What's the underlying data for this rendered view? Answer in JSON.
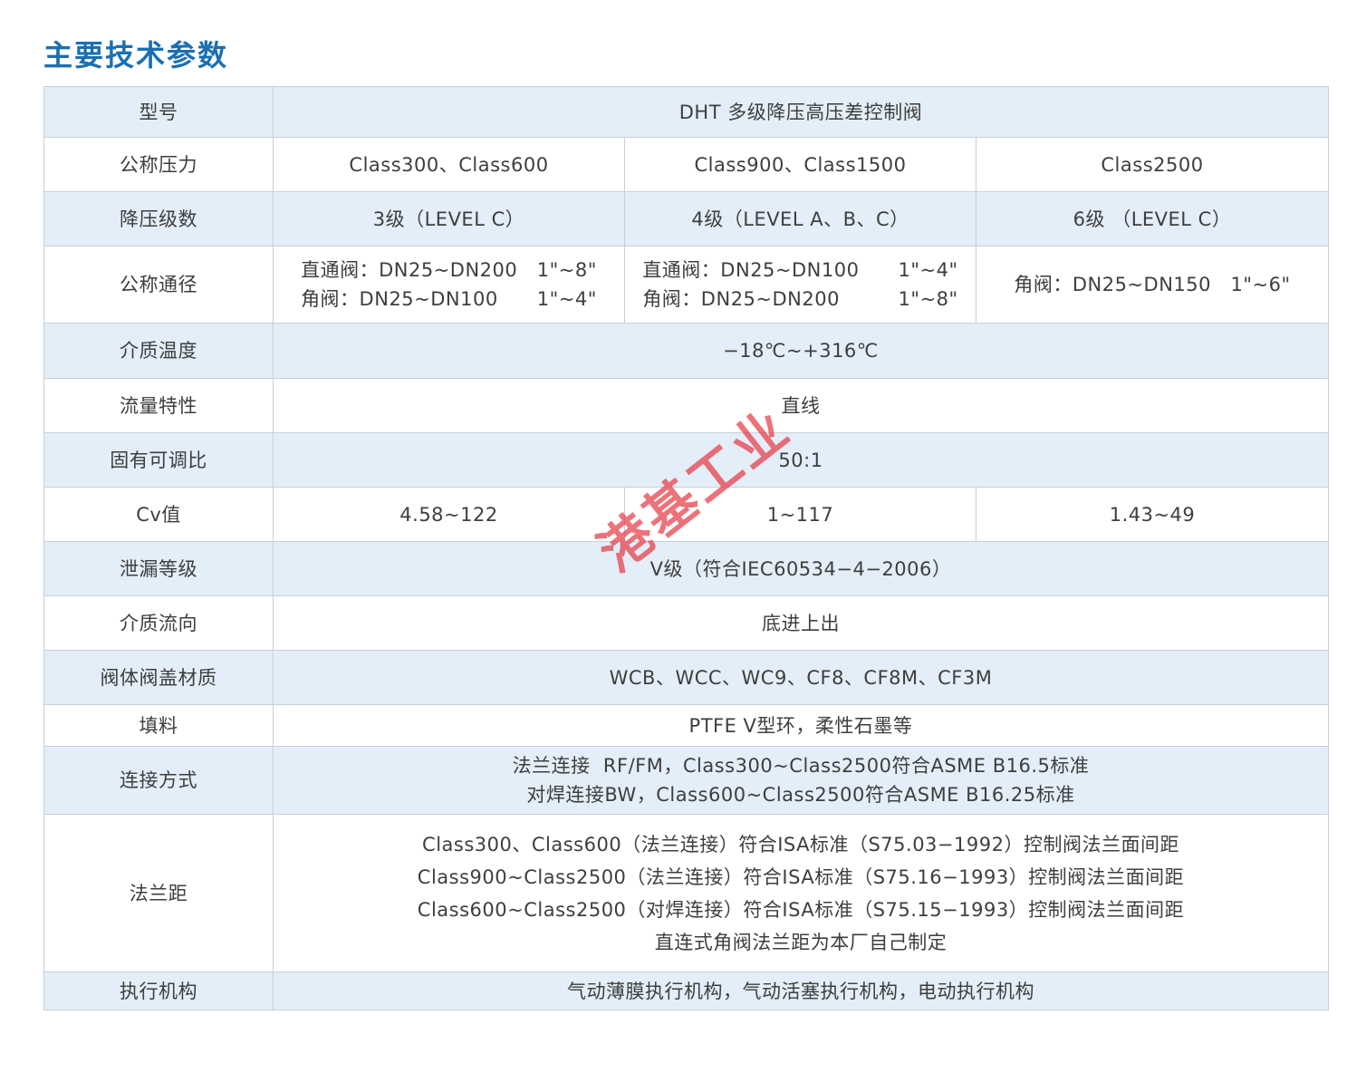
{
  "heading": "主要技术参数",
  "rows": [
    {
      "label": "型号",
      "value": "DHT 多级降压高压差控制阀"
    },
    {
      "label": "公称压力",
      "cells": [
        "Class300、Class600",
        "Class900、Class1500",
        "Class2500"
      ]
    },
    {
      "label": "降压级数",
      "cells": [
        "3级（LEVEL C）",
        "4级（LEVEL A、B、C）",
        "6级 （LEVEL C）"
      ]
    },
    {
      "label": "公称通径",
      "c1": [
        "直通阀：DN25~DN200   1\"~8\"",
        "角阀：DN25~DN100      1\"~4\""
      ],
      "c2": [
        "直通阀：DN25~DN100      1\"~4\"",
        "角阀：DN25~DN200         1\"~8\""
      ],
      "c3": "角阀：DN25~DN150   1\"~6\""
    },
    {
      "label": "介质温度",
      "value": "−18℃~+316℃"
    },
    {
      "label": "流量特性",
      "value": "直线"
    },
    {
      "label": "固有可调比",
      "value": "50:1"
    },
    {
      "label": "Cv值",
      "cells": [
        "4.58~122",
        "1~117",
        "1.43~49"
      ]
    },
    {
      "label": "泄漏等级",
      "value": "V级（符合IEC60534−4−2006）"
    },
    {
      "label": "介质流向",
      "value": "底进上出"
    },
    {
      "label": "阀体阀盖材质",
      "value": "WCB、WCC、WC9、CF8、CF8M、CF3M"
    },
    {
      "label": "填料",
      "value": "PTFE V型环，柔性石墨等"
    },
    {
      "label": "连接方式",
      "lines": [
        "法兰连接  RF/FM，Class300~Class2500符合ASME B16.5标准",
        "对焊连接BW，Class600~Class2500符合ASME B16.25标准"
      ]
    },
    {
      "label": "法兰距",
      "lines": [
        "Class300、Class600（法兰连接）符合ISA标准（S75.03−1992）控制阀法兰面间距",
        "Class900~Class2500（法兰连接）符合ISA标准（S75.16−1993）控制阀法兰面间距",
        "Class600~Class2500（对焊连接）符合ISA标准（S75.15−1993）控制阀法兰面间距",
        "直连式角阀法兰距为本厂自己制定"
      ]
    },
    {
      "label": "执行机构",
      "value": "气动薄膜执行机构，气动活塞执行机构，电动执行机构"
    }
  ],
  "watermark": "港基工业"
}
